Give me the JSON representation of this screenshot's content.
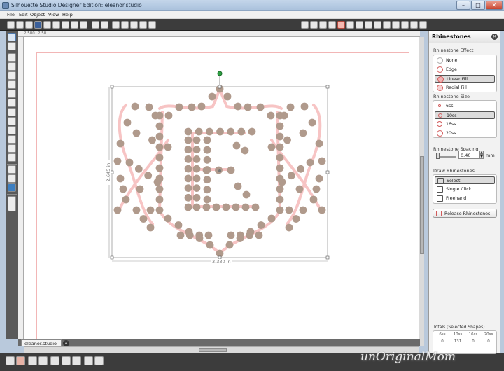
{
  "window": {
    "title": "Silhouette Studio Designer Edition: eleanor.studio"
  },
  "menu": [
    "File",
    "Edit",
    "Object",
    "View",
    "Help"
  ],
  "rulers": {
    "top_marks": [
      "2.500",
      "2.50"
    ]
  },
  "selection": {
    "width_label": "3.330 in",
    "height_label": "2.645 in"
  },
  "doc_tab": {
    "label": "eleanor.studio"
  },
  "panel": {
    "title": "Rhinestones",
    "effect_label": "Rhinestone Effect",
    "effects": [
      "None",
      "Edge",
      "Linear Fill",
      "Radial Fill"
    ],
    "effect_selected": "Linear Fill",
    "size_label": "Rhinestone Size",
    "sizes": [
      "6ss",
      "10ss",
      "16ss",
      "20ss"
    ],
    "size_selected": "10ss",
    "spacing_label": "Rhinestone Spacing",
    "spacing_value": "0.40",
    "spacing_unit": "mm",
    "draw_label": "Draw Rhinestones",
    "draw_modes": [
      "Select",
      "Single Click",
      "Freehand"
    ],
    "draw_selected": "Select",
    "release_label": "Release Rhinestones",
    "totals_label": "Totals (Selected Shapes)",
    "totals": [
      {
        "size": "6ss",
        "count": "0"
      },
      {
        "size": "10ss",
        "count": "131"
      },
      {
        "size": "16ss",
        "count": "0"
      },
      {
        "size": "20ss",
        "count": "0"
      }
    ]
  },
  "colors": {
    "rhinestone": "#b09a8c",
    "guide": "#f7c4c4",
    "accent": "#d25a5a"
  },
  "watermark": "unOriginalMom"
}
